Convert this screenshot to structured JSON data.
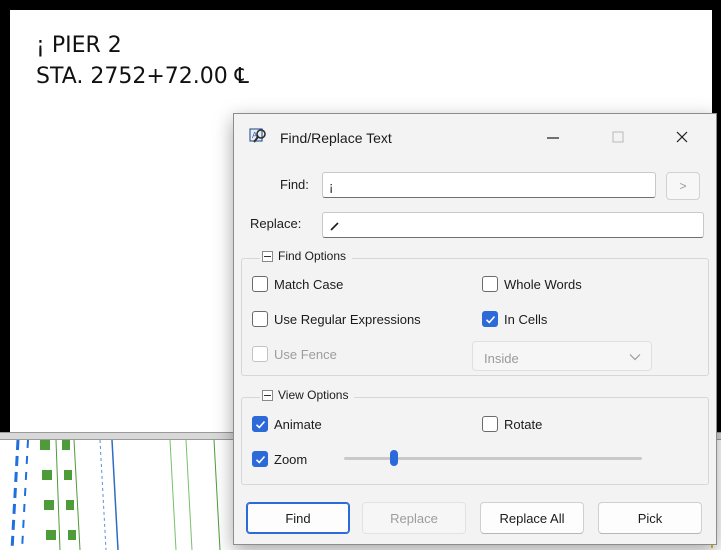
{
  "drawing": {
    "line1": "¡ PIER 2",
    "line2": "STA. 2752+72.00 ℄"
  },
  "dialog": {
    "title": "Find/Replace Text",
    "icons": {
      "app": "find-replace-icon",
      "minimize": "minimize-icon",
      "maximize": "maximize-icon",
      "close": "close-icon"
    }
  },
  "find": {
    "label": "Find:",
    "value": "¡",
    "next_label": ">"
  },
  "replace": {
    "label": "Replace:",
    "value": ""
  },
  "find_options": {
    "title": "Find Options",
    "match_case": {
      "label": "Match Case",
      "checked": false
    },
    "whole_words": {
      "label": "Whole Words",
      "checked": false
    },
    "regex": {
      "label": "Use Regular Expressions",
      "checked": false
    },
    "in_cells": {
      "label": "In Cells",
      "checked": true
    },
    "use_fence": {
      "label": "Use Fence",
      "checked": false,
      "enabled": false
    },
    "fence_mode": {
      "selected": "Inside"
    }
  },
  "view_options": {
    "title": "View Options",
    "animate": {
      "label": "Animate",
      "checked": true
    },
    "rotate": {
      "label": "Rotate",
      "checked": false
    },
    "zoom": {
      "label": "Zoom",
      "checked": true,
      "slider_fraction": 0.16
    }
  },
  "buttons": {
    "find": "Find",
    "replace": "Replace",
    "replace_all": "Replace All",
    "pick": "Pick"
  },
  "colors": {
    "accent": "#2b6ad8"
  }
}
